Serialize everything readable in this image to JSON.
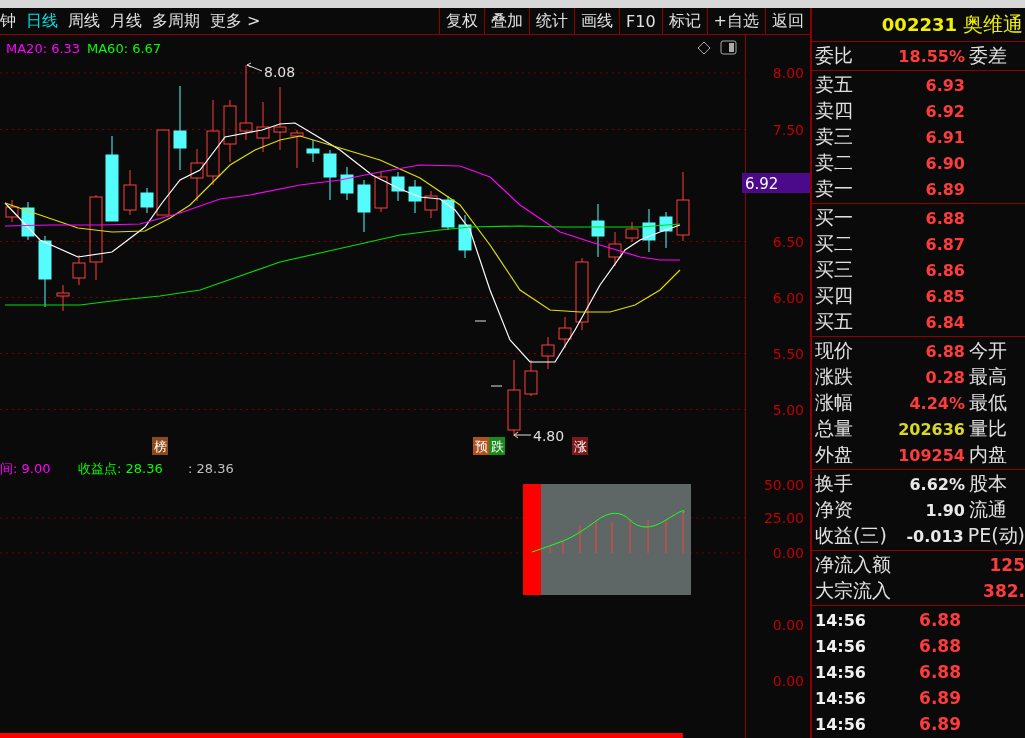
{
  "toolbar": {
    "periods": [
      {
        "label": "钟",
        "selected": false
      },
      {
        "label": "日线",
        "selected": true
      },
      {
        "label": "周线",
        "selected": false
      },
      {
        "label": "月线",
        "selected": false
      },
      {
        "label": "多周期",
        "selected": false
      },
      {
        "label": "更多 >",
        "selected": false
      }
    ],
    "buttons": [
      "复权",
      "叠加",
      "统计",
      "画线",
      "F10",
      "标记",
      "+自选",
      "返回"
    ]
  },
  "chart": {
    "legend": [
      {
        "text": "MA20: 6.33",
        "color": "#ff00ff"
      },
      {
        "text": "MA60: 6.67",
        "color": "#00ff00"
      }
    ],
    "high_label": "8.08",
    "low_label": "4.80",
    "price_axis": [
      "8.00",
      "7.50",
      "6.50",
      "6.00",
      "5.50",
      "5.00"
    ],
    "current_price": "6.92",
    "markers": [
      {
        "text": "榜",
        "color": "#8b4a1a"
      },
      {
        "text": "预",
        "color": "#b0501a"
      },
      {
        "text": "跌",
        "color": "#1a8a1a"
      },
      {
        "text": "涨",
        "color": "#7a1a1a"
      }
    ]
  },
  "indicator": {
    "legend": [
      {
        "text": "间: 9.00",
        "color": "#ff00ff"
      },
      {
        "text": "收益点: 28.36",
        "color": "#00ff00"
      },
      {
        "text": ": 28.36",
        "color": "#c0c0c0"
      }
    ],
    "axis": [
      "50.00",
      "25.00",
      "0.00"
    ]
  },
  "lower_panel": {
    "axis": [
      "0.00",
      "0.00"
    ],
    "scroll": {
      "level": 0.843
    }
  },
  "quote": {
    "code": "002231",
    "name": "奥维通",
    "ratio": {
      "label": "委比",
      "value": "18.55%",
      "label2": "委差"
    },
    "asks": [
      {
        "label": "卖五",
        "price": "6.93"
      },
      {
        "label": "卖四",
        "price": "6.92"
      },
      {
        "label": "卖三",
        "price": "6.91"
      },
      {
        "label": "卖二",
        "price": "6.90"
      },
      {
        "label": "卖一",
        "price": "6.89"
      }
    ],
    "bids": [
      {
        "label": "买一",
        "price": "6.88"
      },
      {
        "label": "买二",
        "price": "6.87"
      },
      {
        "label": "买三",
        "price": "6.86"
      },
      {
        "label": "买四",
        "price": "6.85"
      },
      {
        "label": "买五",
        "price": "6.84"
      }
    ],
    "stats": [
      {
        "label": "现价",
        "value": "6.88",
        "color": "#ff3c3c",
        "label2": "今开"
      },
      {
        "label": "涨跌",
        "value": "0.28",
        "color": "#ff3c3c",
        "label2": "最高"
      },
      {
        "label": "涨幅",
        "value": "4.24%",
        "color": "#ff3c3c",
        "label2": "最低"
      },
      {
        "label": "总量",
        "value": "202636",
        "color": "#d8d820",
        "label2": "量比"
      },
      {
        "label": "外盘",
        "value": "109254",
        "color": "#ff3c3c",
        "label2": "内盘"
      }
    ],
    "finance": [
      {
        "label": "换手",
        "value": "6.62%",
        "label2": "股本"
      },
      {
        "label": "净资",
        "value": "1.90",
        "label2": "流通"
      },
      {
        "label": "收益(三)",
        "value": "-0.013",
        "label2": "PE(动)"
      }
    ],
    "flows": [
      {
        "label": "净流入额",
        "value": "125"
      },
      {
        "label": "大宗流入",
        "value": "382."
      }
    ],
    "trades": [
      {
        "time": "14:56",
        "price": "6.88"
      },
      {
        "time": "14:56",
        "price": "6.88"
      },
      {
        "time": "14:56",
        "price": "6.88"
      },
      {
        "time": "14:56",
        "price": "6.89"
      },
      {
        "time": "14:56",
        "price": "6.89"
      }
    ]
  }
}
